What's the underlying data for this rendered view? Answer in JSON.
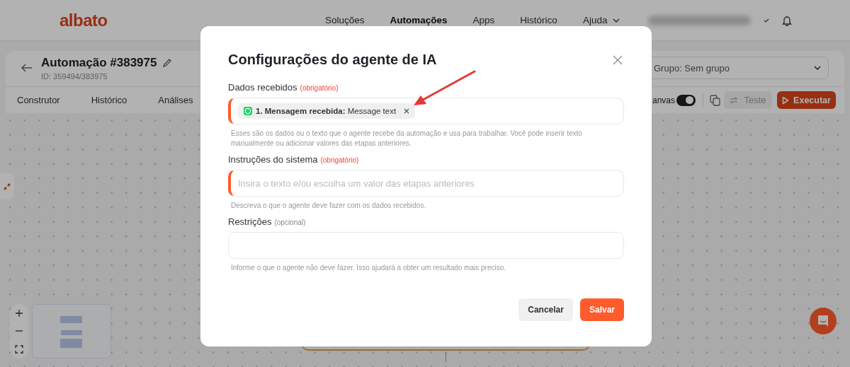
{
  "header": {
    "logo": "albato",
    "nav": [
      {
        "label": "Soluções",
        "selected": false
      },
      {
        "label": "Automações",
        "selected": true
      },
      {
        "label": "Apps",
        "selected": false
      },
      {
        "label": "Histórico",
        "selected": false
      }
    ],
    "help": "Ajuda"
  },
  "automation": {
    "title": "Automação #383975",
    "id": "ID: 359494/383975",
    "group": "Grupo: Sem grupo",
    "tabs": [
      "Construtor",
      "Histórico",
      "Análises"
    ],
    "canvas_label": "anvas",
    "canvas_toggle_on": true,
    "test_button": {
      "label": "Teste",
      "disabled": true
    },
    "run_button": "Executar"
  },
  "modal": {
    "title": "Configurações do agente de IA",
    "fields": [
      {
        "label": "Dados recebidos",
        "tag": "(obrigatório)",
        "required": true,
        "marked": true,
        "chips": [
          {
            "text": "**1. Mensagem recebida:** Message text"
          }
        ],
        "hint": "Esses são os dados ou o texto que o agente recebe da automação e usa para trabalhar. Você pode inserir texto manualmente ou adicionar valores das etapas anteriores."
      },
      {
        "label": "Instruções do sistema",
        "tag": "(obrigatório)",
        "required": true,
        "marked": true,
        "placeholder": "Insira o texto e/ou escolha um valor das etapas anteriores",
        "hint": "Descreva o que o agente deve fazer com os dados recebidos."
      },
      {
        "label": "Restrições",
        "tag": "(opcional)",
        "required": false,
        "marked": false,
        "hint": "Informe o que o agente não deve fazer. Isso ajudará a obter um resultado mais preciso."
      }
    ],
    "buttons": [
      {
        "label": "Cancelar",
        "kind": "secondary"
      },
      {
        "label": "Salvar",
        "kind": "primary"
      }
    ]
  }
}
